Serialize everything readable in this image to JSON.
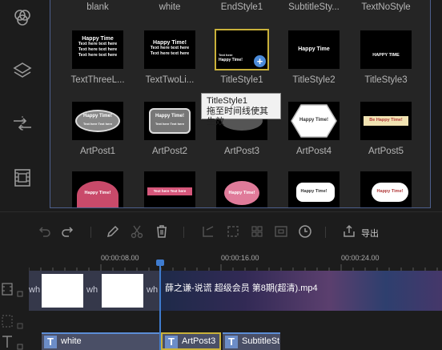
{
  "rail": {
    "items": [
      "overlay-icon",
      "layers-icon",
      "transition-icon",
      "film-icon"
    ]
  },
  "library": {
    "row0": [
      "blank",
      "white",
      "EndStyle1",
      "SubtitleSty...",
      "TextNoStyle"
    ],
    "row1": [
      {
        "label": "TextThreeL...",
        "thumb_title": "Happy Time",
        "thumb_lines": [
          "Text here text here",
          "Text here text here",
          "Text here text here"
        ]
      },
      {
        "label": "TextTwoLi...",
        "thumb_title": "Happy Time!",
        "thumb_lines": [
          "Text here text here",
          "Text here text here"
        ]
      },
      {
        "label": "TitleStyle1",
        "thumb_title": "Happy Time!",
        "thumb_lines": [
          "Text here"
        ]
      },
      {
        "label": "TitleStyle2",
        "thumb_title": "Happy Time",
        "thumb_lines": []
      },
      {
        "label": "TitleStyle3",
        "thumb_title": "HAPPY TIME",
        "thumb_lines": []
      }
    ],
    "row2": [
      {
        "label": "ArtPost1",
        "thumb_title": "Happy Time!",
        "thumb_lines": [
          "Text here Text here"
        ]
      },
      {
        "label": "ArtPost2",
        "thumb_title": "Happy Time!",
        "thumb_lines": [
          "Text here Text here"
        ]
      },
      {
        "label": "ArtPost3",
        "thumb_title": "Happy Time!",
        "thumb_lines": []
      },
      {
        "label": "ArtPost4",
        "thumb_title": "Happy Time!",
        "thumb_lines": []
      },
      {
        "label": "ArtPost5",
        "thumb_title": "Be Happy Time!",
        "thumb_lines": []
      }
    ],
    "row3": [
      {
        "thumb_title": "Happy Time!"
      },
      {
        "thumb_title": "Text here Text here"
      },
      {
        "thumb_title": "Happy Time!"
      },
      {
        "thumb_title": "Happy Time!"
      },
      {
        "thumb_title": "Happy Time!"
      }
    ],
    "tooltip": {
      "line1": "TitleStyle1",
      "line2": "拖至时间线使其生效"
    }
  },
  "toolbar": {
    "export_label": "导出"
  },
  "ruler": {
    "times": [
      "00:00:08.00",
      "00:00:16.00",
      "00:00:24.00"
    ]
  },
  "timeline": {
    "video_clip_labels": [
      "wh",
      "wh"
    ],
    "movie_title": "薛之谦-说谎 超级会员 第8期(超清).mp4",
    "text_clips": [
      "white",
      "ArtPost3",
      "SubtitleSt"
    ]
  },
  "colors": {
    "accent": "#3f7ccf",
    "selection": "#c9b13a",
    "panel_border": "#4d5f8d"
  }
}
